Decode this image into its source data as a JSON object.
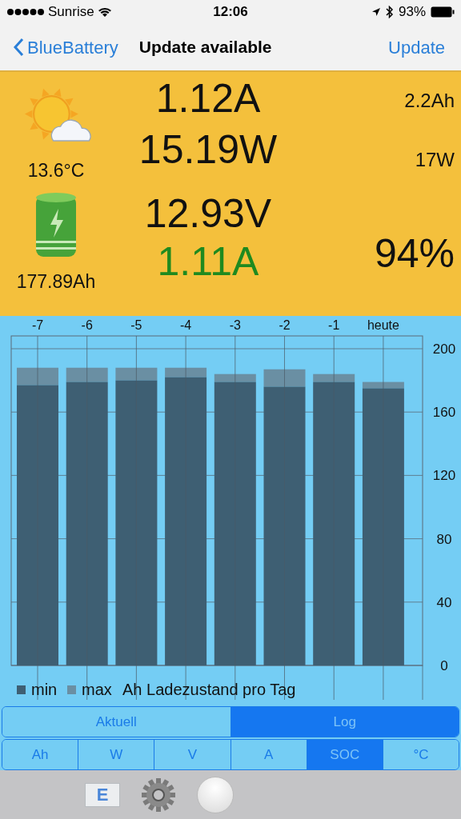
{
  "status_bar": {
    "carrier": "Sunrise",
    "time": "12:06",
    "battery": "93%"
  },
  "nav": {
    "back": "BlueBattery",
    "title": "Update available",
    "action": "Update"
  },
  "readings": {
    "temperature": "13.6°C",
    "capacity": "177.89Ah",
    "current": "1.12A",
    "power": "15.19W",
    "voltage": "12.93V",
    "current_2": "1.11A",
    "charge": "2.2Ah",
    "power_2": "17W",
    "soc": "94%"
  },
  "chart_data": {
    "type": "bar",
    "categories": [
      "-7",
      "-6",
      "-5",
      "-4",
      "-3",
      "-2",
      "-1",
      "heute"
    ],
    "stacked": true,
    "grid": true,
    "legend": true,
    "ylim": [
      0,
      200
    ],
    "yticks": [
      0,
      40,
      80,
      120,
      160,
      200
    ],
    "series": [
      {
        "name": "min",
        "color": "#3e5f73",
        "values": [
          177,
          179,
          180,
          182,
          179,
          176,
          179,
          175
        ]
      },
      {
        "name": "max",
        "color": "#6a8fa3",
        "values": [
          11,
          9,
          8,
          6,
          5,
          11,
          5,
          4
        ]
      }
    ],
    "title": "Ah Ladezustand pro Tag"
  },
  "view_tabs": [
    {
      "label": "Aktuell",
      "selected": false
    },
    {
      "label": "Log",
      "selected": true
    }
  ],
  "unit_tabs": [
    {
      "label": "Ah",
      "selected": false
    },
    {
      "label": "W",
      "selected": false
    },
    {
      "label": "V",
      "selected": false
    },
    {
      "label": "A",
      "selected": false
    },
    {
      "label": "SOC",
      "selected": true
    },
    {
      "label": "°C",
      "selected": false
    }
  ],
  "toolbar": {
    "mail_letter": "E"
  }
}
